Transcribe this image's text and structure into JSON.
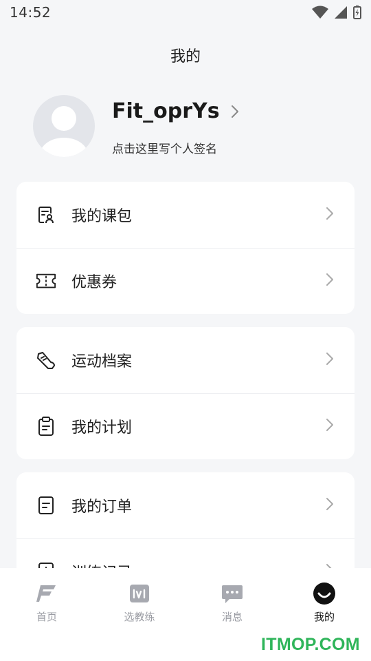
{
  "status_bar": {
    "time": "14:52"
  },
  "page_title": "我的",
  "profile": {
    "username": "Fit_oprYs",
    "signature": "点击这里写个人签名"
  },
  "cards": [
    {
      "items": [
        {
          "label": "我的课包",
          "icon": "course-package-icon"
        },
        {
          "label": "优惠券",
          "icon": "coupon-icon"
        }
      ]
    },
    {
      "items": [
        {
          "label": "运动档案",
          "icon": "sneaker-icon"
        },
        {
          "label": "我的计划",
          "icon": "clipboard-icon"
        }
      ]
    },
    {
      "items": [
        {
          "label": "我的订单",
          "icon": "order-icon"
        },
        {
          "label": "训练记录",
          "icon": "record-icon"
        }
      ]
    }
  ],
  "tabbar": {
    "tabs": [
      {
        "label": "首页",
        "icon": "home-logo-icon"
      },
      {
        "label": "选教练",
        "icon": "1v1-icon"
      },
      {
        "label": "消息",
        "icon": "message-icon"
      },
      {
        "label": "我的",
        "icon": "profile-smile-icon"
      }
    ],
    "active_index": 3
  },
  "watermark": "ITMOP.COM",
  "colors": {
    "background": "#f5f6f8",
    "card": "#ffffff",
    "watermark": "#2fb55a",
    "tab_inactive": "#9a9ca3"
  }
}
